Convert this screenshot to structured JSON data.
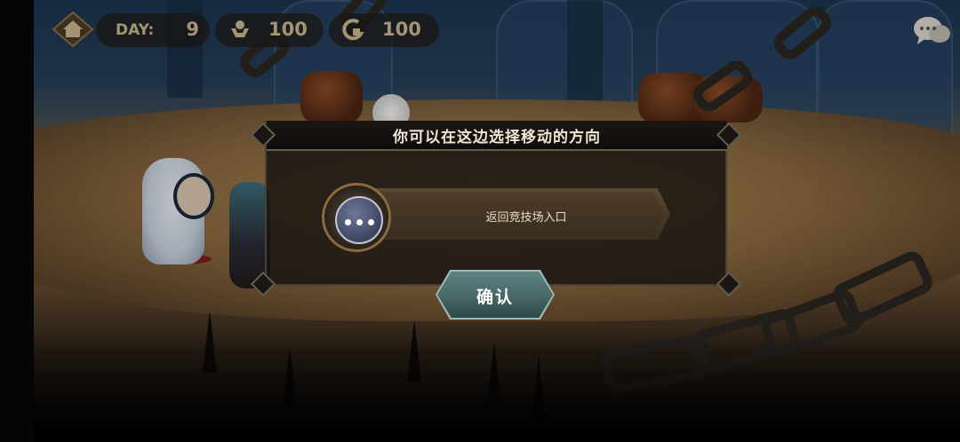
{
  "hud": {
    "day_label": "DAY:",
    "day_value": "9",
    "population_value": "100",
    "gold_value": "100",
    "icons": [
      "home-icon",
      "population-icon",
      "gold-icon",
      "chat-icon"
    ]
  },
  "dialog": {
    "title": "你可以在这边选择移动的方向",
    "options": [
      {
        "label": "返回竞技场入口",
        "icon": "more-dots-icon"
      }
    ],
    "confirm_label": "确认"
  },
  "colors": {
    "hud_text": "#c7b58e",
    "dialog_title": "#f0e6d2",
    "confirm_button": "#476767",
    "option_banner": "#4a3a26"
  }
}
